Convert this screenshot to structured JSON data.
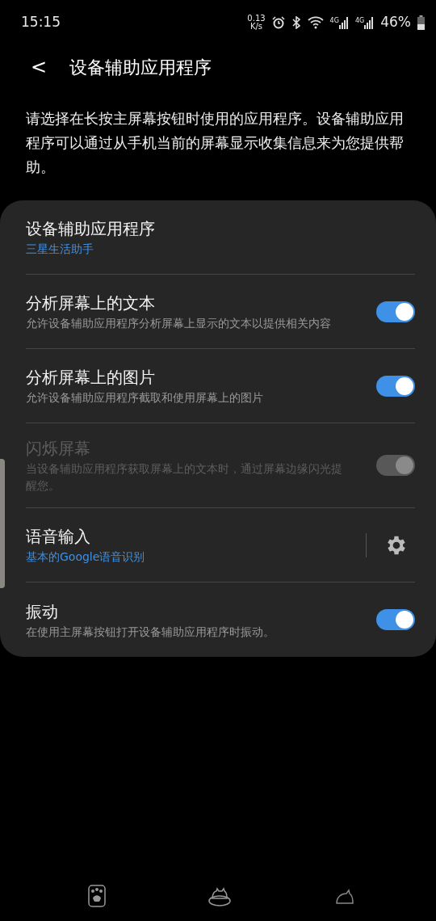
{
  "status_bar": {
    "time": "15:15",
    "speed": "0.13",
    "speed_unit": "K/s",
    "network_1": "4G",
    "network_2": "4G",
    "battery": "46%"
  },
  "header": {
    "back": "<",
    "title": "设备辅助应用程序"
  },
  "description": "请选择在长按主屏幕按钮时使用的应用程序。设备辅助应用程序可以通过从手机当前的屏幕显示收集信息来为您提供帮助。",
  "settings": [
    {
      "kind": "value",
      "title": "设备辅助应用程序",
      "value": "三星生活助手"
    },
    {
      "kind": "toggle",
      "title": "分析屏幕上的文本",
      "subtitle": "允许设备辅助应用程序分析屏幕上显示的文本以提供相关内容",
      "on": true,
      "disabled": false
    },
    {
      "kind": "toggle",
      "title": "分析屏幕上的图片",
      "subtitle": "允许设备辅助应用程序截取和使用屏幕上的图片",
      "on": true,
      "disabled": false
    },
    {
      "kind": "toggle",
      "title": "闪烁屏幕",
      "subtitle": "当设备辅助应用程序获取屏幕上的文本时，通过屏幕边缘闪光提醒您。",
      "on": true,
      "disabled": true
    },
    {
      "kind": "settings",
      "title": "语音输入",
      "value": "基本的Google语音识别"
    },
    {
      "kind": "toggle",
      "title": "振动",
      "subtitle": "在使用主屏幕按钮打开设备辅助应用程序时振动。",
      "on": true,
      "disabled": false
    }
  ]
}
